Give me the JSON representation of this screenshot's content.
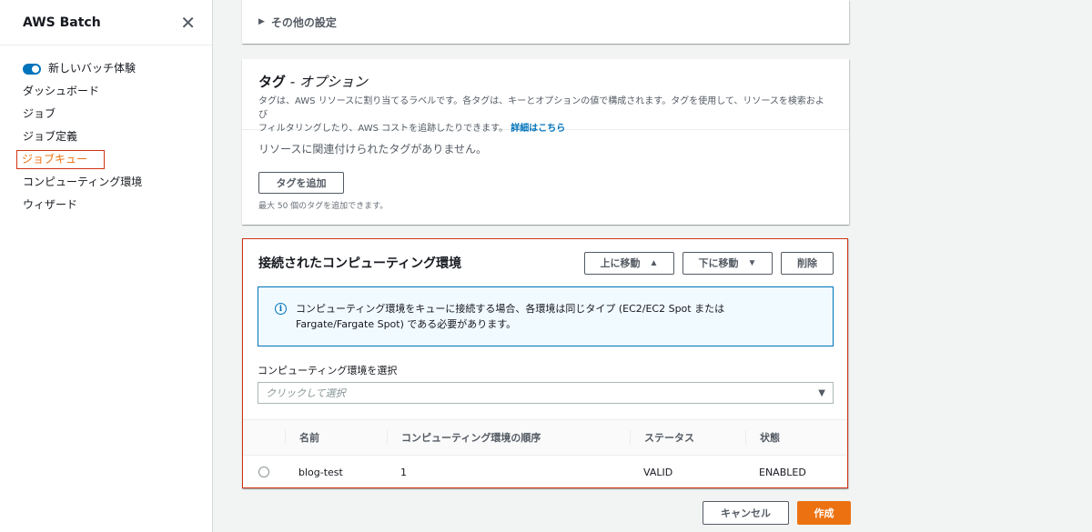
{
  "sidebar": {
    "title": "AWS Batch",
    "toggle_label": "新しいバッチ体験",
    "items": [
      {
        "label": "ダッシュボード"
      },
      {
        "label": "ジョブ"
      },
      {
        "label": "ジョブ定義"
      },
      {
        "label": "ジョブキュー"
      },
      {
        "label": "コンピューティング環境"
      },
      {
        "label": "ウィザード"
      }
    ]
  },
  "other_settings": {
    "label": "その他の設定"
  },
  "tags": {
    "title": "タグ",
    "title_sep": " - ",
    "title_optional": "オプション",
    "description_line1": "タグは、AWS リソースに割り当てるラベルです。各タグは、キーとオプションの値で構成されます。タグを使用して、リソースを検索および",
    "description_line2": "フィルタリングしたり、AWS コストを追跡したりできます。",
    "learn_more": "詳細はこちら",
    "empty_text": "リソースに関連付けられたタグがありません。",
    "add_button": "タグを追加",
    "limit_hint": "最大 50 個のタグを追加できます。"
  },
  "compute_envs": {
    "title": "接続されたコンピューティング環境",
    "move_up": "上に移動",
    "move_down": "下に移動",
    "delete": "削除",
    "info_line1": "コンピューティング環境をキューに接続する場合、各環境は同じタイプ (EC2/EC2 Spot または",
    "info_line2": "Fargate/Fargate Spot) である必要があります。",
    "select_label": "コンピューティング環境を選択",
    "select_placeholder": "クリックして選択",
    "columns": {
      "name": "名前",
      "order": "コンピューティング環境の順序",
      "status": "ステータス",
      "state": "状態"
    },
    "rows": [
      {
        "name": "blog-test",
        "order": "1",
        "status": "VALID",
        "state": "ENABLED"
      }
    ]
  },
  "footer": {
    "cancel": "キャンセル",
    "create": "作成"
  },
  "colors": {
    "accent": "#ec7211",
    "link": "#0073bb",
    "highlight_border": "#d13212"
  }
}
